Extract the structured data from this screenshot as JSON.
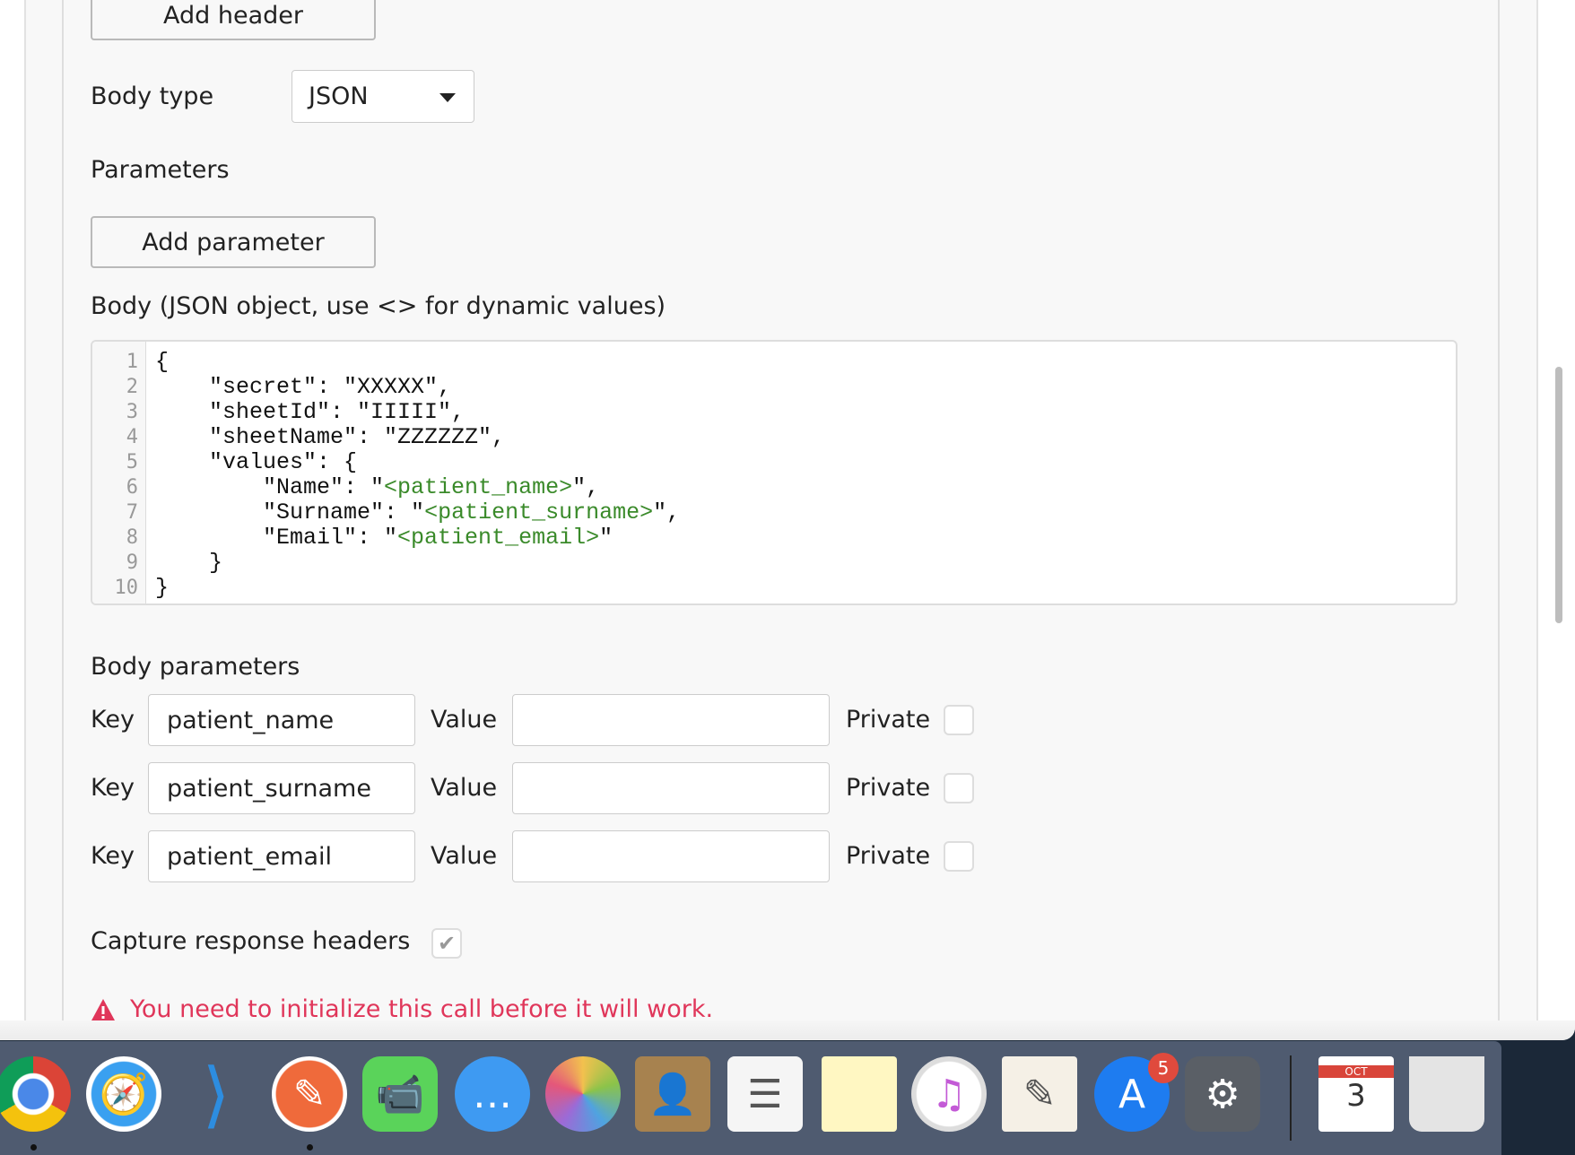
{
  "form": {
    "add_header_label": "Add header",
    "body_type_label": "Body type",
    "body_type_value": "JSON",
    "parameters_label": "Parameters",
    "add_parameter_label": "Add parameter",
    "body_label": "Body (JSON object, use <> for dynamic values)",
    "code_lines": [
      {
        "n": "1",
        "pre": "{",
        "dyn": "",
        "post": ""
      },
      {
        "n": "2",
        "pre": "    \"secret\": \"XXXXX\",",
        "dyn": "",
        "post": ""
      },
      {
        "n": "3",
        "pre": "    \"sheetId\": \"IIIII\",",
        "dyn": "",
        "post": ""
      },
      {
        "n": "4",
        "pre": "    \"sheetName\": \"ZZZZZZ\",",
        "dyn": "",
        "post": ""
      },
      {
        "n": "5",
        "pre": "    \"values\": {",
        "dyn": "",
        "post": ""
      },
      {
        "n": "6",
        "pre": "        \"Name\": \"",
        "dyn": "<patient_name>",
        "post": "\","
      },
      {
        "n": "7",
        "pre": "        \"Surname\": \"",
        "dyn": "<patient_surname>",
        "post": "\","
      },
      {
        "n": "8",
        "pre": "        \"Email\": \"",
        "dyn": "<patient_email>",
        "post": "\""
      },
      {
        "n": "9",
        "pre": "    }",
        "dyn": "",
        "post": ""
      },
      {
        "n": "10",
        "pre": "}",
        "dyn": "",
        "post": ""
      }
    ],
    "body_parameters_label": "Body parameters",
    "rows": [
      {
        "key_label": "Key",
        "key": "patient_name",
        "value_label": "Value",
        "value": "",
        "private_label": "Private",
        "private": false
      },
      {
        "key_label": "Key",
        "key": "patient_surname",
        "value_label": "Value",
        "value": "",
        "private_label": "Private",
        "private": false
      },
      {
        "key_label": "Key",
        "key": "patient_email",
        "value_label": "Value",
        "value": "",
        "private_label": "Private",
        "private": false
      }
    ],
    "capture_label": "Capture response headers",
    "capture_checked": true,
    "error_message": "You need to initialize this call before it will work.",
    "error_color": "#e0365a"
  },
  "dock": {
    "items": [
      {
        "name": "chrome",
        "running": true
      },
      {
        "name": "safari",
        "running": false
      },
      {
        "name": "vscode",
        "running": false
      },
      {
        "name": "postman",
        "running": true
      },
      {
        "name": "facetime",
        "running": false
      },
      {
        "name": "messages",
        "running": false
      },
      {
        "name": "photos",
        "running": false
      },
      {
        "name": "contacts",
        "running": false
      },
      {
        "name": "reminders",
        "running": false
      },
      {
        "name": "notes",
        "running": false
      },
      {
        "name": "itunes",
        "running": false
      },
      {
        "name": "pages",
        "running": false
      },
      {
        "name": "app-store",
        "running": false,
        "badge": "5"
      },
      {
        "name": "system-preferences",
        "running": false
      },
      {
        "name": "calendar-file",
        "running": false,
        "month": "OCT",
        "day": "3"
      },
      {
        "name": "trash",
        "running": false
      }
    ]
  }
}
